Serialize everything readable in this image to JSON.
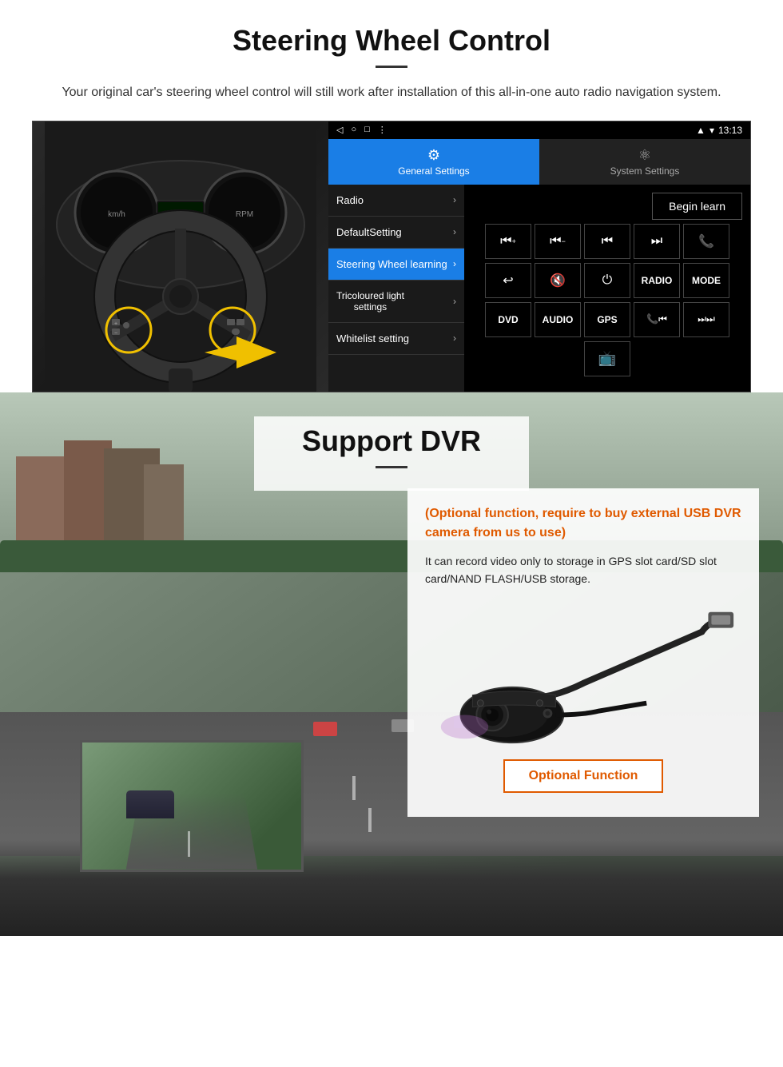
{
  "steering": {
    "title": "Steering Wheel Control",
    "subtitle": "Your original car's steering wheel control will still work after installation of this all-in-one auto radio navigation system.",
    "statusbar": {
      "nav_back": "◁",
      "nav_home": "○",
      "nav_square": "□",
      "nav_dots": "⋮",
      "time": "13:13",
      "signal": "▾",
      "wifi": "▾"
    },
    "tabs": [
      {
        "id": "general",
        "icon": "⚙",
        "label": "General Settings",
        "active": true
      },
      {
        "id": "system",
        "icon": "⚛",
        "label": "System Settings",
        "active": false
      }
    ],
    "menu": [
      {
        "id": "radio",
        "label": "Radio",
        "active": false
      },
      {
        "id": "default",
        "label": "DefaultSetting",
        "active": false
      },
      {
        "id": "steering",
        "label": "Steering Wheel learning",
        "active": true
      },
      {
        "id": "tricoloured",
        "label": "Tricoloured light settings",
        "active": false
      },
      {
        "id": "whitelist",
        "label": "Whitelist setting",
        "active": false
      }
    ],
    "begin_learn": "Begin learn",
    "control_rows": [
      [
        "⏮+",
        "⏮−",
        "⏮⏮",
        "⏭⏭",
        "📞"
      ],
      [
        "↩",
        "🔇",
        "⏻",
        "RADIO",
        "MODE"
      ],
      [
        "DVD",
        "AUDIO",
        "GPS",
        "📞⏮",
        "⏭⏭"
      ]
    ],
    "extra_btn": "📺"
  },
  "dvr": {
    "title": "Support DVR",
    "optional_text": "(Optional function, require to buy external USB DVR camera from us to use)",
    "description": "It can record video only to storage in GPS slot card/SD slot card/NAND FLASH/USB storage.",
    "optional_function_btn": "Optional Function"
  }
}
